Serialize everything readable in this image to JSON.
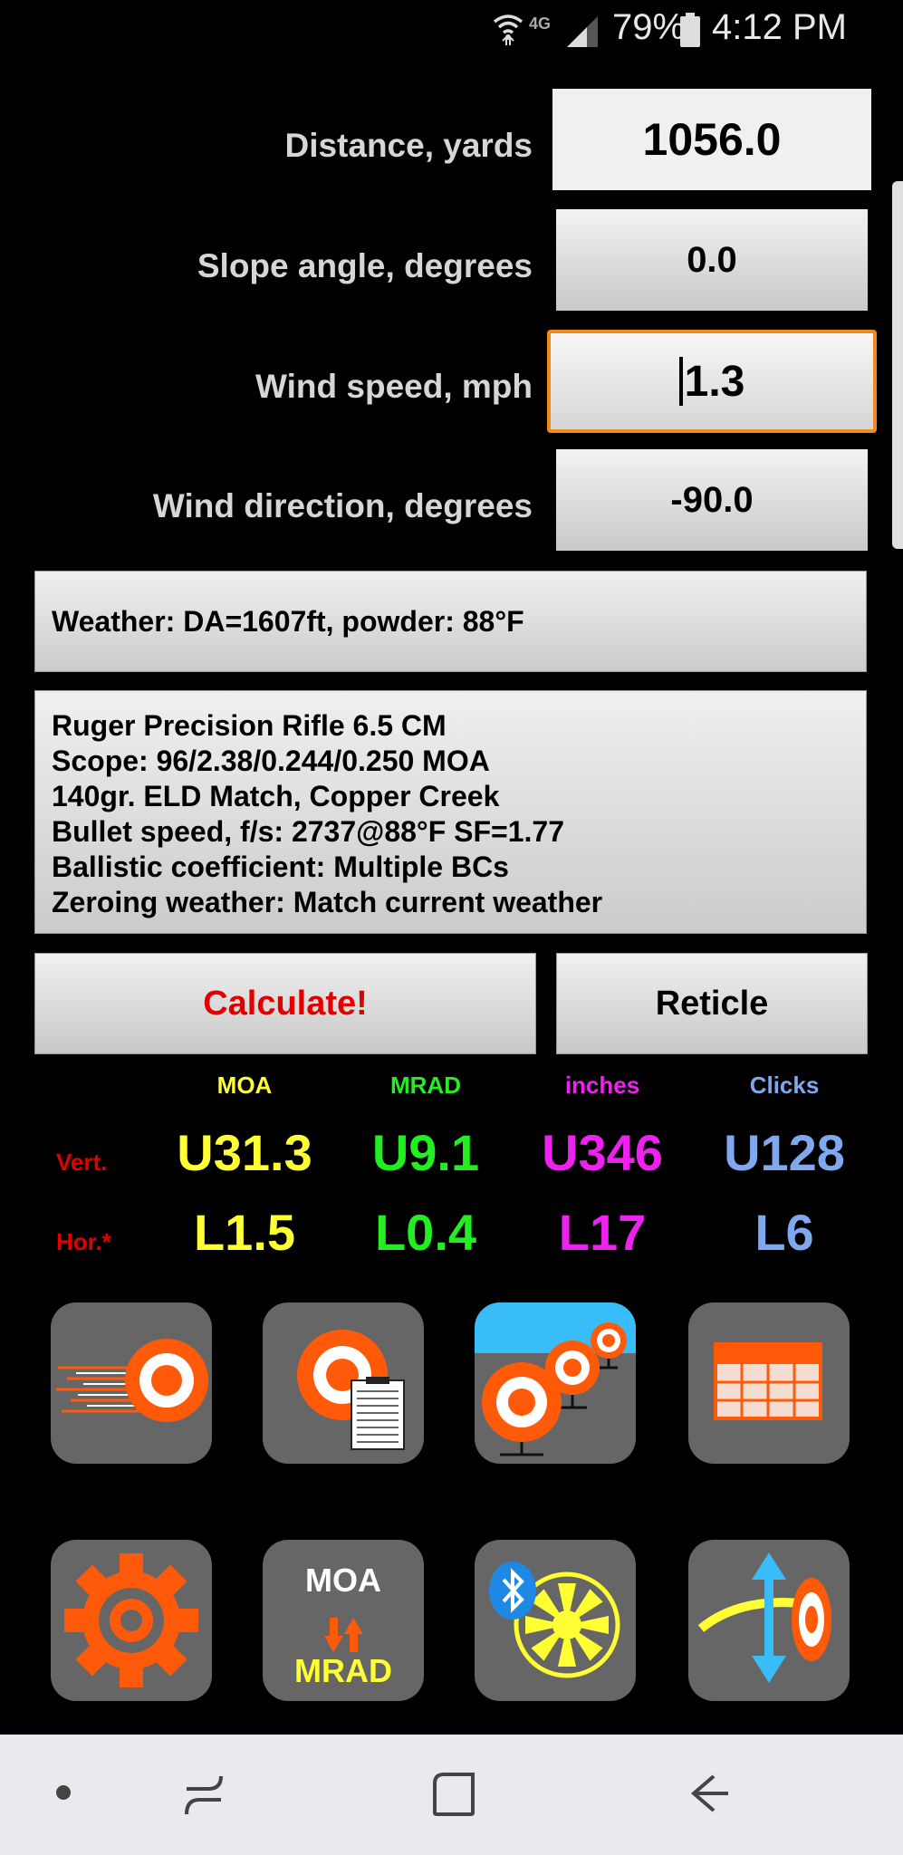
{
  "status_bar": {
    "network": "4G",
    "battery": "79%",
    "time": "4:12 PM"
  },
  "fields": [
    {
      "label": "Distance, yards",
      "value": "1056.0"
    },
    {
      "label": "Slope angle, degrees",
      "value": "0.0"
    },
    {
      "label": "Wind speed, mph",
      "value": "1.3"
    },
    {
      "label": "Wind direction, degrees",
      "value": "-90.0"
    }
  ],
  "weather": "Weather: DA=1607ft, powder: 88°F",
  "profile": {
    "lines": [
      "Ruger Precision Rifle 6.5 CM",
      "Scope: 96/2.38/0.244/0.250 MOA",
      "140gr. ELD Match, Copper Creek",
      "Bullet speed, f/s: 2737@88°F SF=1.77",
      "Ballistic coefficient: Multiple BCs",
      "Zeroing weather: Match current weather"
    ]
  },
  "buttons": {
    "calculate": "Calculate!",
    "reticle": "Reticle"
  },
  "results": {
    "columns": [
      "MOA",
      "MRAD",
      "inches",
      "Clicks"
    ],
    "rows": [
      {
        "label": "Vert.",
        "values": [
          "U31.3",
          "U9.1",
          "U346",
          "U128"
        ]
      },
      {
        "label": "Hor.*",
        "values": [
          "L1.5",
          "L0.4",
          "L17",
          "L6"
        ]
      }
    ]
  },
  "colors": {
    "moa": "#ffff33",
    "mrad": "#22ee22",
    "inches": "#ee22ee",
    "clicks": "#7fa8ee",
    "calculate": "#e00000",
    "focus": "#f08a1c",
    "icon_orange": "#ff5a0a"
  },
  "tiles": [
    {
      "icon": "trajectory-target-icon"
    },
    {
      "icon": "target-notes-icon"
    },
    {
      "icon": "multiple-targets-icon"
    },
    {
      "icon": "range-table-icon"
    },
    {
      "icon": "settings-gear-icon"
    },
    {
      "icon": "moa-mrad-converter-icon",
      "top_text": "MOA",
      "bottom_text": "MRAD"
    },
    {
      "icon": "bluetooth-wind-meter-icon"
    },
    {
      "icon": "reticle-adjustment-icon"
    }
  ]
}
